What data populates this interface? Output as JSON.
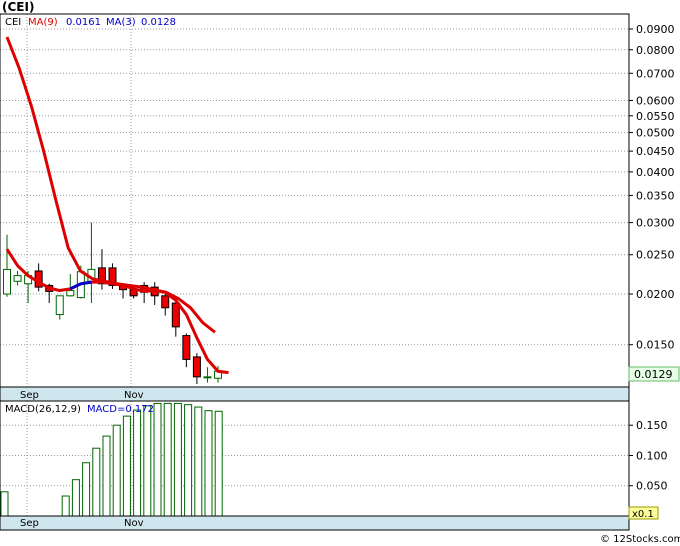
{
  "header": {
    "ticker": "(CEI)",
    "legend_symbol": "CEI",
    "ma9_label": "MA(9)",
    "ma9_value": "0.0161",
    "ma3_label": "MA(3)",
    "ma3_value": "0.0128",
    "ma9_color": "#dd0000",
    "ma3_color": "#0000cc"
  },
  "price_panel": {
    "y_ticks": [
      "0.0900",
      "0.0800",
      "0.0700",
      "0.0600",
      "0.0550",
      "0.0500",
      "0.0450",
      "0.0400",
      "0.0350",
      "0.0300",
      "0.0250",
      "0.0200",
      "0.0150"
    ],
    "last_price_label": "0.0129",
    "x_labels": [
      "Sep",
      "Nov"
    ]
  },
  "macd_panel": {
    "label": "MACD(26,12,9)",
    "value_text": "MACD=0.172",
    "y_ticks": [
      "0.150",
      "0.100",
      "0.050"
    ],
    "scale_label": "x0.1",
    "x_labels": [
      "Sep",
      "Nov"
    ]
  },
  "footer": {
    "copyright": "© 12Stocks.com"
  },
  "chart_data": [
    {
      "type": "candlestick",
      "title": "(CEI)",
      "scale": "log",
      "ylim": [
        0.0118,
        0.098
      ],
      "candles": [
        {
          "o": 0.02,
          "h": 0.028,
          "l": 0.0197,
          "c": 0.023
        },
        {
          "o": 0.0215,
          "h": 0.0228,
          "l": 0.021,
          "c": 0.0222
        },
        {
          "o": 0.0212,
          "h": 0.0228,
          "l": 0.019,
          "c": 0.0222
        },
        {
          "o": 0.0228,
          "h": 0.0238,
          "l": 0.0203,
          "c": 0.0208
        },
        {
          "o": 0.021,
          "h": 0.0212,
          "l": 0.019,
          "c": 0.0203
        },
        {
          "o": 0.0178,
          "h": 0.0198,
          "l": 0.0173,
          "c": 0.0198
        },
        {
          "o": 0.0198,
          "h": 0.0224,
          "l": 0.0197,
          "c": 0.0204
        },
        {
          "o": 0.0196,
          "h": 0.0235,
          "l": 0.0195,
          "c": 0.0227
        },
        {
          "o": 0.0215,
          "h": 0.03,
          "l": 0.019,
          "c": 0.023
        },
        {
          "o": 0.0232,
          "h": 0.0258,
          "l": 0.0205,
          "c": 0.0212
        },
        {
          "o": 0.0232,
          "h": 0.0238,
          "l": 0.0206,
          "c": 0.021
        },
        {
          "o": 0.021,
          "h": 0.0212,
          "l": 0.0195,
          "c": 0.0205
        },
        {
          "o": 0.0205,
          "h": 0.021,
          "l": 0.0195,
          "c": 0.0198
        },
        {
          "o": 0.021,
          "h": 0.0214,
          "l": 0.019,
          "c": 0.0202
        },
        {
          "o": 0.0208,
          "h": 0.0214,
          "l": 0.0188,
          "c": 0.0198
        },
        {
          "o": 0.0198,
          "h": 0.0204,
          "l": 0.0177,
          "c": 0.0185
        },
        {
          "o": 0.019,
          "h": 0.0193,
          "l": 0.0157,
          "c": 0.0166
        },
        {
          "o": 0.0158,
          "h": 0.016,
          "l": 0.0132,
          "c": 0.0138
        },
        {
          "o": 0.014,
          "h": 0.0143,
          "l": 0.012,
          "c": 0.0125
        },
        {
          "o": 0.0125,
          "h": 0.0132,
          "l": 0.0121,
          "c": 0.0125
        },
        {
          "o": 0.0124,
          "h": 0.0133,
          "l": 0.0121,
          "c": 0.0129
        }
      ],
      "series": [
        {
          "name": "MA(9)",
          "color": "#dd0000",
          "values": [
            0.086,
            0.072,
            0.058,
            0.045,
            0.034,
            0.026,
            0.0228,
            0.0218,
            0.0215,
            0.0212,
            0.021,
            0.0208,
            0.0205,
            0.0202,
            0.0195,
            0.0185,
            0.017,
            0.0161
          ]
        },
        {
          "name": "MA(3)",
          "color": "#dd0000",
          "values": [
            0.0258,
            0.0235,
            0.0222,
            0.0214,
            0.0207,
            0.0204,
            0.0206,
            0.0212,
            0.0214,
            0.0214,
            0.0212,
            0.021,
            0.0206,
            0.0203,
            0.0204,
            0.0202,
            0.0193,
            0.0178,
            0.0156,
            0.0138,
            0.0129,
            0.0128
          ]
        }
      ]
    },
    {
      "type": "bar",
      "title": "MACD(26,12,9)",
      "ylim": [
        0.0,
        0.19
      ],
      "values": [
        0.04,
        0.0,
        0.0,
        0.0,
        0.0,
        0.0,
        0.033,
        0.06,
        0.088,
        0.112,
        0.132,
        0.15,
        0.165,
        0.175,
        0.182,
        0.186,
        0.186,
        0.186,
        0.184,
        0.18,
        0.174,
        0.173
      ],
      "ylabel": "",
      "xlabel": ""
    }
  ]
}
